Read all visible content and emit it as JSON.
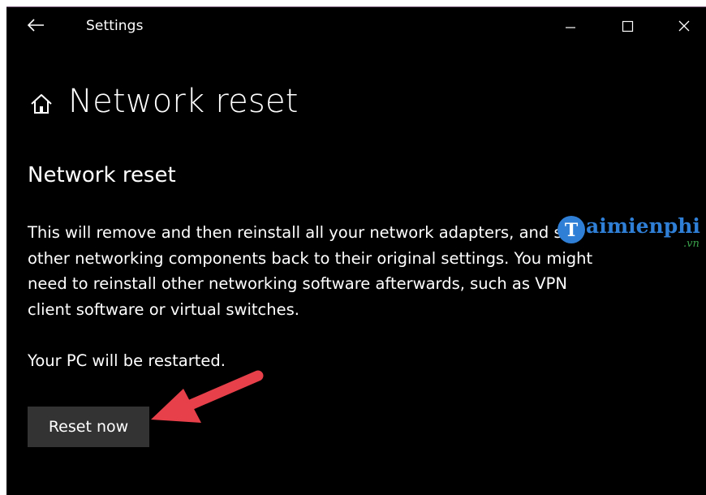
{
  "window": {
    "title": "Settings",
    "back_icon": "back-arrow-icon",
    "minimize_icon": "minimize-icon",
    "maximize_icon": "maximize-icon",
    "close_icon": "close-icon"
  },
  "header": {
    "icon": "home-icon",
    "title": "Network reset"
  },
  "main": {
    "section_title": "Network reset",
    "description": "This will remove and then reinstall all your network adapters, and set other networking components back to their original settings. You might need to reinstall other networking software afterwards, such as VPN client software or virtual switches.",
    "restart_note": "Your PC will be restarted.",
    "reset_button_label": "Reset now"
  },
  "watermark": {
    "logo_letter": "T",
    "text": "aimienphi",
    "suffix": ".vn"
  },
  "colors": {
    "background": "#000000",
    "button": "#333333",
    "annotation_arrow": "#e8404a",
    "watermark_blue": "#2f7fd6"
  }
}
